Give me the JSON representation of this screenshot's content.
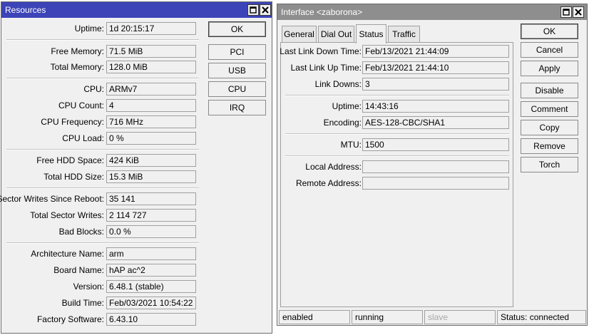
{
  "resources": {
    "title": "Resources",
    "rows": [
      {
        "label": "Uptime:",
        "value": "1d 20:15:17"
      },
      {
        "label": "Free Memory:",
        "value": "71.5 MiB"
      },
      {
        "label": "Total Memory:",
        "value": "128.0 MiB"
      },
      {
        "label": "CPU:",
        "value": "ARMv7"
      },
      {
        "label": "CPU Count:",
        "value": "4"
      },
      {
        "label": "CPU Frequency:",
        "value": "716 MHz"
      },
      {
        "label": "CPU Load:",
        "value": "0 %"
      },
      {
        "label": "Free HDD Space:",
        "value": "424 KiB"
      },
      {
        "label": "Total HDD Size:",
        "value": "15.3 MiB"
      },
      {
        "label": "Sector Writes Since Reboot:",
        "value": "35 141"
      },
      {
        "label": "Total Sector Writes:",
        "value": "2 114 727"
      },
      {
        "label": "Bad Blocks:",
        "value": "0.0 %"
      },
      {
        "label": "Architecture Name:",
        "value": "arm"
      },
      {
        "label": "Board Name:",
        "value": "hAP ac^2"
      },
      {
        "label": "Version:",
        "value": "6.48.1 (stable)"
      },
      {
        "label": "Build Time:",
        "value": "Feb/03/2021 10:54:22"
      },
      {
        "label": "Factory Software:",
        "value": "6.43.10"
      }
    ],
    "buttons": {
      "ok": "OK",
      "pci": "PCI",
      "usb": "USB",
      "cpu": "CPU",
      "irq": "IRQ"
    }
  },
  "interface": {
    "title": "Interface <zaborona>",
    "tabs": [
      "General",
      "Dial Out",
      "Status",
      "Traffic"
    ],
    "active_tab": "Status",
    "rows": [
      {
        "label": "Last Link Down Time:",
        "value": "Feb/13/2021 21:44:09"
      },
      {
        "label": "Last Link Up Time:",
        "value": "Feb/13/2021 21:44:10"
      },
      {
        "label": "Link Downs:",
        "value": "3"
      },
      {
        "label": "Uptime:",
        "value": "14:43:16"
      },
      {
        "label": "Encoding:",
        "value": "AES-128-CBC/SHA1"
      },
      {
        "label": "MTU:",
        "value": "1500"
      },
      {
        "label": "Local Address:",
        "value": ""
      },
      {
        "label": "Remote Address:",
        "value": ""
      }
    ],
    "buttons": {
      "ok": "OK",
      "cancel": "Cancel",
      "apply": "Apply",
      "disable": "Disable",
      "comment": "Comment",
      "copy": "Copy",
      "remove": "Remove",
      "torch": "Torch"
    },
    "statusbar": {
      "state": "enabled",
      "running": "running",
      "slave": "slave",
      "status": "Status: connected"
    }
  }
}
